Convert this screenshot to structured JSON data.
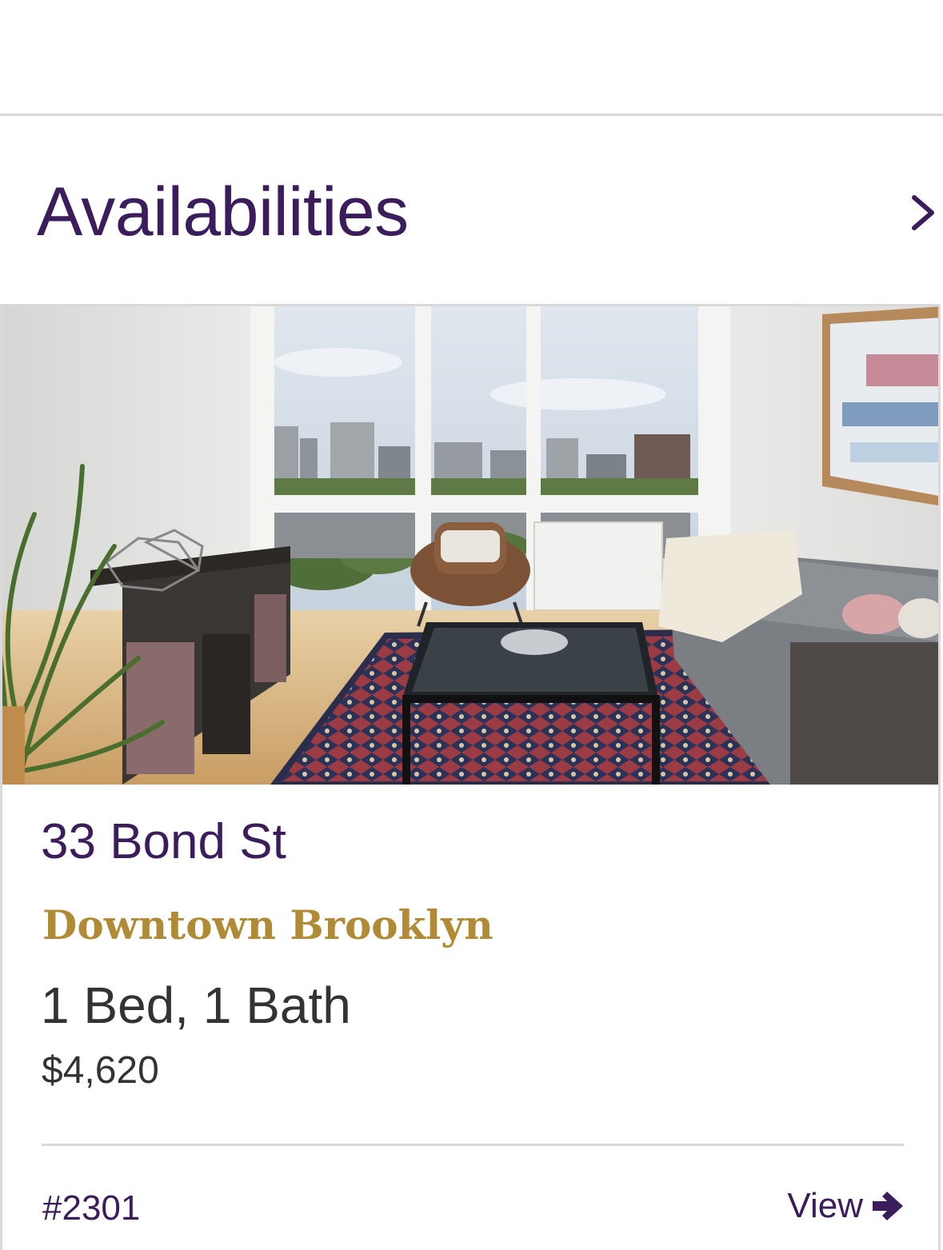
{
  "section": {
    "title": "Availabilities",
    "chevron_icon": "chevron-right-icon"
  },
  "listing": {
    "photo_description_icon": "listing-photo",
    "building": "33 Bond St",
    "neighborhood": "Downtown Brooklyn",
    "layout": "1 Bed, 1 Bath",
    "price": "$4,620",
    "unit": "#2301",
    "view_label": "View",
    "view_icon": "arrow-right-icon"
  },
  "colors": {
    "brand_purple": "#3b1d5c",
    "neighborhood_gold": "#b08a35",
    "divider_gray": "#d9d9d9",
    "body_text": "#333333"
  }
}
